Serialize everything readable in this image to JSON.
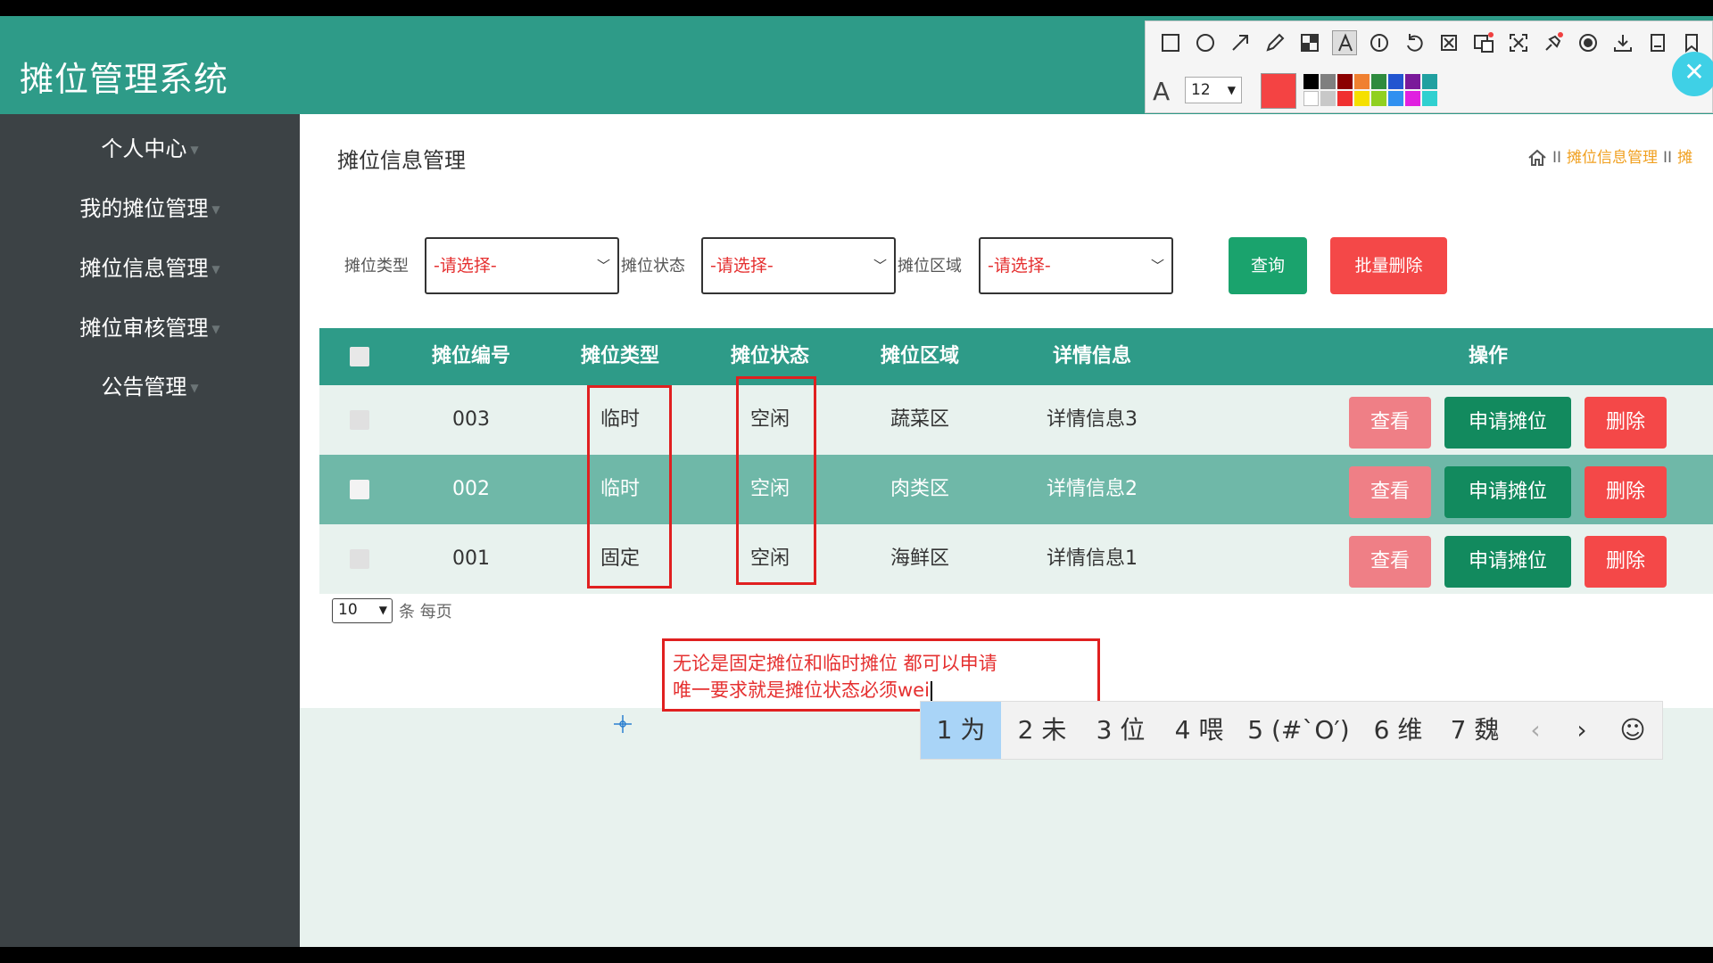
{
  "app": {
    "title": "摊位管理系统"
  },
  "sidebar": {
    "items": [
      {
        "label": "个人中心"
      },
      {
        "label": "我的摊位管理"
      },
      {
        "label": "摊位信息管理"
      },
      {
        "label": "摊位审核管理"
      },
      {
        "label": "公告管理"
      }
    ]
  },
  "page": {
    "title": "摊位信息管理",
    "breadcrumb": {
      "current": "摊位信息管理",
      "next": "摊"
    }
  },
  "filters": {
    "type": {
      "label": "摊位类型",
      "value": "-请选择-"
    },
    "status": {
      "label": "摊位状态",
      "value": "-请选择-"
    },
    "area": {
      "label": "摊位区域",
      "value": "-请选择-"
    },
    "query_label": "查询",
    "bulk_delete_label": "批量删除"
  },
  "table": {
    "headers": {
      "number": "摊位编号",
      "type": "摊位类型",
      "status": "摊位状态",
      "area": "摊位区域",
      "detail": "详情信息",
      "actions": "操作"
    },
    "rows": [
      {
        "number": "003",
        "type": "临时",
        "status": "空闲",
        "area": "蔬菜区",
        "detail": "详情信息3"
      },
      {
        "number": "002",
        "type": "临时",
        "status": "空闲",
        "area": "肉类区",
        "detail": "详情信息2"
      },
      {
        "number": "001",
        "type": "固定",
        "status": "空闲",
        "area": "海鲜区",
        "detail": "详情信息1"
      }
    ],
    "actions": {
      "view": "查看",
      "apply": "申请摊位",
      "delete": "删除"
    }
  },
  "pagination": {
    "page_size": "10",
    "label": "条 每页"
  },
  "annotation": {
    "line1": "无论是固定摊位和临时摊位 都可以申请",
    "line2": "唯一要求就是摊位状态必须wei"
  },
  "ime": {
    "candidates": [
      "1 为",
      "2 未",
      "3 位",
      "4 喂",
      "5 (#`O′)",
      "6 维",
      "7 魏"
    ],
    "prev": "‹",
    "next": "›",
    "emoji": "☺"
  },
  "toolbar": {
    "font_size": "12",
    "current_color": "#f44343",
    "palette_top": [
      "#000000",
      "#7f7f7f",
      "#8b0000",
      "#f08030",
      "#2e8b3e",
      "#2255d0",
      "#7a1a9a",
      "#20a0a0"
    ],
    "palette_bottom": [
      "#ffffff",
      "#c8c8c8",
      "#f03030",
      "#f5e000",
      "#90d020",
      "#3090f0",
      "#e020e0",
      "#30d0d0"
    ]
  },
  "colors": {
    "header": "#2e9b88",
    "sidebar": "#3c4245",
    "query": "#1aa36d",
    "danger": "#f44848",
    "view": "#ef7f86",
    "apply": "#128a5e"
  }
}
